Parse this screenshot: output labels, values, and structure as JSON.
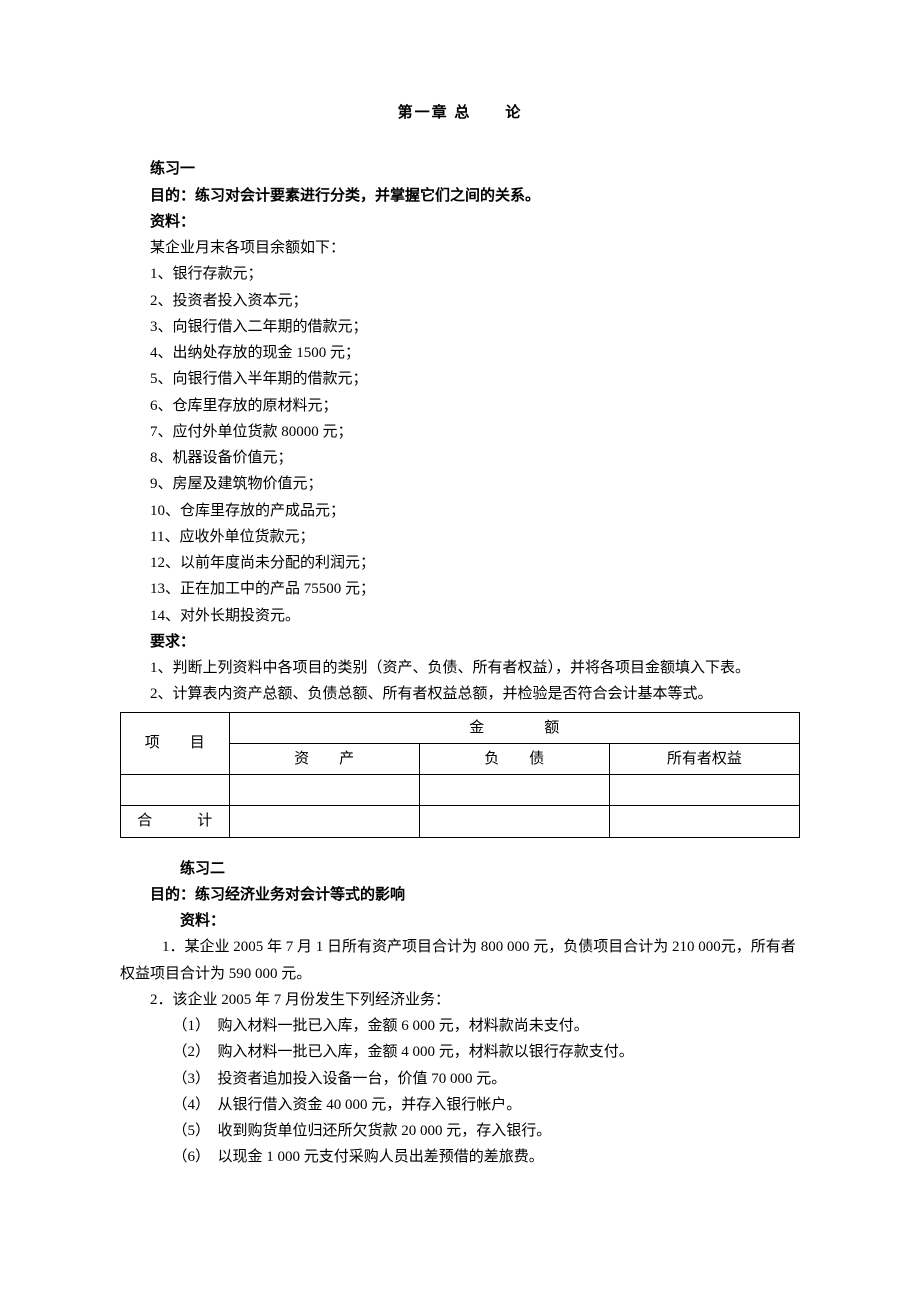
{
  "title": "第一章 总　　论",
  "ex1": {
    "heading": "练习一",
    "goal_label": "目的：练习对会计要素进行分类，并掌握它们之间的关系。",
    "material_label": "资料：",
    "intro": "某企业月末各项目余额如下：",
    "items": [
      "1、银行存款元；",
      "2、投资者投入资本元；",
      "3、向银行借入二年期的借款元；",
      "4、出纳处存放的现金 1500 元；",
      "5、向银行借入半年期的借款元；",
      "6、仓库里存放的原材料元；",
      "7、应付外单位货款 80000 元；",
      "8、机器设备价值元；",
      "9、房屋及建筑物价值元；",
      "10、仓库里存放的产成品元；",
      "11、应收外单位货款元；",
      "12、以前年度尚未分配的利润元；",
      "13、正在加工中的产品 75500 元；",
      "14、对外长期投资元。"
    ],
    "req_label": "要求：",
    "req1": "1、判断上列资料中各项目的类别（资产、负债、所有者权益），并将各项目金额填入下表。",
    "req2": "2、计算表内资产总额、负债总额、所有者权益总额，并检验是否符合会计基本等式。",
    "table": {
      "project": "项　　目",
      "amount": "金　　　　额",
      "assets": "资　　产",
      "liab": "负　　债",
      "equity": "所有者权益",
      "total": "合　　　计"
    }
  },
  "ex2": {
    "heading": "练习二",
    "goal_label": "目的：练习经济业务对会计等式的影响",
    "material_label": "资料：",
    "para1": "1．某企业 2005 年 7 月 1 日所有资产项目合计为 800  000 元，负债项目合计为 210  000元，所有者权益项目合计为 590  000 元。",
    "para2": "2．该企业 2005 年 7 月份发生下列经济业务：",
    "tx": [
      "（1）　购入材料一批已入库，金额 6  000 元，材料款尚未支付。",
      "（2）　购入材料一批已入库，金额 4  000 元，材料款以银行存款支付。",
      "（3）　投资者追加投入设备一台，价值 70  000 元。",
      "（4）　从银行借入资金 40  000 元，并存入银行帐户。",
      "（5）　收到购货单位归还所欠货款 20  000 元，存入银行。",
      "（6）　以现金 1  000 元支付采购人员出差预借的差旅费。"
    ]
  }
}
